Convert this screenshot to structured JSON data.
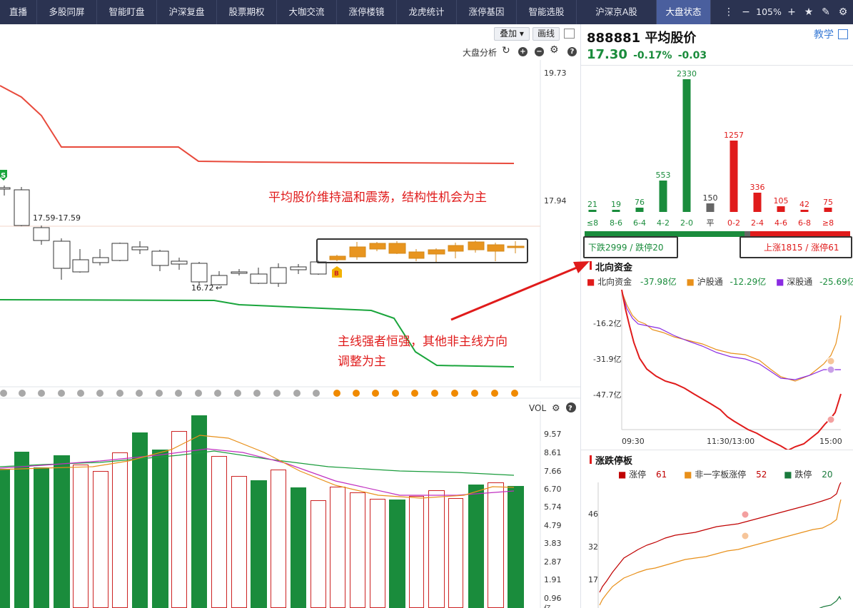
{
  "tabs": [
    {
      "label": "直播",
      "active": false
    },
    {
      "label": "多股同屏",
      "active": false
    },
    {
      "label": "智能盯盘",
      "active": false
    },
    {
      "label": "沪深复盘",
      "active": false
    },
    {
      "label": "股票期权",
      "active": false
    },
    {
      "label": "大咖交流",
      "active": false
    },
    {
      "label": "涨停楼镜",
      "active": false
    },
    {
      "label": "龙虎统计",
      "active": false
    },
    {
      "label": "涨停基因",
      "active": false
    },
    {
      "label": "智能选股",
      "active": false
    },
    {
      "label": "沪深京A股",
      "active": false
    },
    {
      "label": "大盘状态",
      "active": true
    }
  ],
  "window": {
    "zoom": "105%"
  },
  "toolbar": {
    "overlay_label": "叠加",
    "draw_label": "画线",
    "analysis_label": "大盘分析"
  },
  "kline": {
    "price_ticks": [
      "19.73",
      "17.94"
    ],
    "high_label": "17.59-17.59",
    "low_label": "16.72",
    "buy_marker": "B",
    "sell_marker": "S",
    "annotation_top": "平均股价维持温和震荡，结构性机会为主",
    "annotation_bottom_line1": "主线强者恒强，其他非主线方向",
    "annotation_bottom_line2": "调整为主"
  },
  "volume": {
    "label": "VOL",
    "ticks": [
      "9.57",
      "8.61",
      "7.66",
      "6.70",
      "5.74",
      "4.79",
      "3.83",
      "2.87",
      "1.91",
      "0.96"
    ],
    "unit": "亿"
  },
  "quote": {
    "code": "888881",
    "name": "平均股价",
    "price": "17.30",
    "change_pct": "-0.17%",
    "change": "-0.03",
    "teach_label": "教学"
  },
  "distribution": {
    "categories": [
      "≤8",
      "8-6",
      "6-4",
      "4-2",
      "2-0",
      "平",
      "0-2",
      "2-4",
      "4-6",
      "6-8",
      "≥8"
    ],
    "values": [
      21,
      19,
      76,
      553,
      2330,
      150,
      1257,
      336,
      105,
      42,
      75
    ],
    "colors": [
      "#1a8c3c",
      "#1a8c3c",
      "#1a8c3c",
      "#1a8c3c",
      "#1a8c3c",
      "#666666",
      "#e01b1b",
      "#e01b1b",
      "#e01b1b",
      "#e01b1b",
      "#e01b1b"
    ],
    "down_label": "下跌2999 / 跌停20",
    "up_label": "上涨1815 / 涨停61"
  },
  "north": {
    "title": "北向资金",
    "legend": [
      {
        "name": "北向资金",
        "value": "-37.98亿",
        "color": "#e01b1b"
      },
      {
        "name": "沪股通",
        "value": "-12.29亿",
        "color": "#e8901a"
      },
      {
        "name": "深股通",
        "value": "-25.69亿",
        "color": "#8a2be2"
      }
    ],
    "y_ticks": [
      "-16.2亿",
      "-31.9亿",
      "-47.7亿"
    ],
    "x_ticks": [
      "09:30",
      "11:30/13:00",
      "15:00"
    ]
  },
  "limit": {
    "title": "涨跌停板",
    "legend": [
      {
        "name": "涨停",
        "value": "61",
        "color": "#c00000"
      },
      {
        "name": "非一字板涨停",
        "value": "52",
        "color": "#e8901a"
      },
      {
        "name": "跌停",
        "value": "20",
        "color": "#1a7a3c"
      }
    ],
    "y_ticks": [
      "46",
      "32",
      "17"
    ]
  },
  "colors": {
    "up": "#e01b1b",
    "down": "#1a8c3c",
    "tabbar": "#2b3351",
    "accent": "#3a7bd5"
  }
}
